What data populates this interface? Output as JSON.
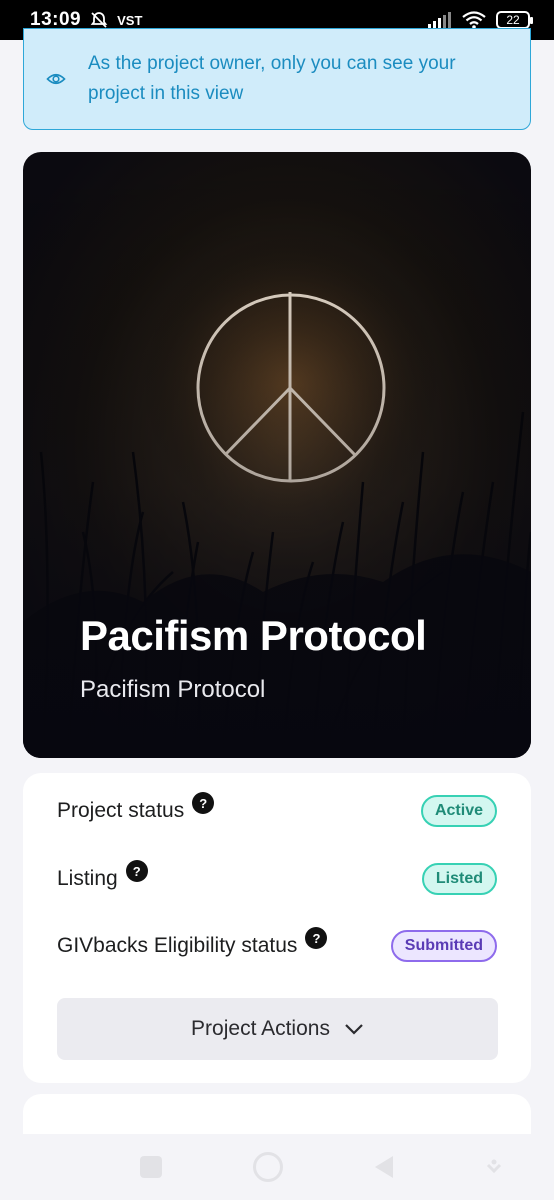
{
  "status_bar": {
    "time": "13:09",
    "carrier": "VST",
    "battery": "22"
  },
  "notice": {
    "icon": "eye-icon",
    "text": "As the project owner, only you can see your project in this view",
    "color": "#1b8cc0",
    "background": "#d0ecfa"
  },
  "project": {
    "title": "Pacifism Protocol",
    "subtitle": "Pacifism Protocol"
  },
  "status_rows": [
    {
      "label": "Project status",
      "badge": "Active",
      "badge_style": "green"
    },
    {
      "label": "Listing",
      "badge": "Listed",
      "badge_style": "green"
    },
    {
      "label": "GIVbacks Eligibility status",
      "badge": "Submitted",
      "badge_style": "purple"
    }
  ],
  "help_icon_text": "?",
  "actions": {
    "label": "Project Actions",
    "icon": "chevron-down-icon"
  },
  "colors": {
    "badge_green_border": "#37d1b4",
    "badge_purple_border": "#8e6bec"
  }
}
